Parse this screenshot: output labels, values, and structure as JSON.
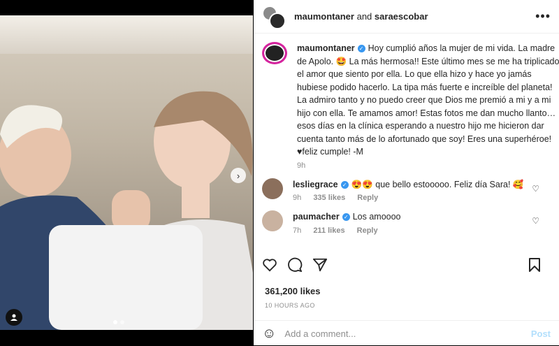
{
  "post": {
    "header": {
      "author": "maumontaner",
      "joiner": "and",
      "coauthor": "saraescobar",
      "more_icon": "ellipsis-icon"
    },
    "caption": {
      "username": "maumontaner",
      "text": "Hoy cumplió años la mujer de mi vida. La madre de Apolo. 🤩 La más hermosa!! Este último mes se me ha triplicado el amor que siento por ella. Lo que ella hizo y hace yo jamás hubiese podido hacerlo. La tipa más fuerte e increíble del planeta! La admiro tanto y no puedo creer que Dios me premió a mi y a mi hijo con ella. Te amamos amor! Estas fotos me dan mucho llanto… esos días en la clínica esperando a nuestro hijo me hicieron dar cuenta tanto más de lo afortunado que soy! Eres una superhéroe! ♥feliz cumple! -M",
      "time": "9h"
    },
    "comments": [
      {
        "username": "lesliegrace",
        "text": "😍😍 que bello estooooo. Feliz día Sara! 🥰",
        "time": "9h",
        "likes": "335 likes",
        "reply": "Reply"
      },
      {
        "username": "paumacher",
        "text": "Los amoooo",
        "time": "7h",
        "likes": "211 likes",
        "reply": "Reply"
      }
    ],
    "likes": "361,200 likes",
    "posted_ago": "10 HOURS AGO",
    "comment_input": {
      "placeholder": "Add a comment...",
      "post_label": "Post"
    }
  }
}
